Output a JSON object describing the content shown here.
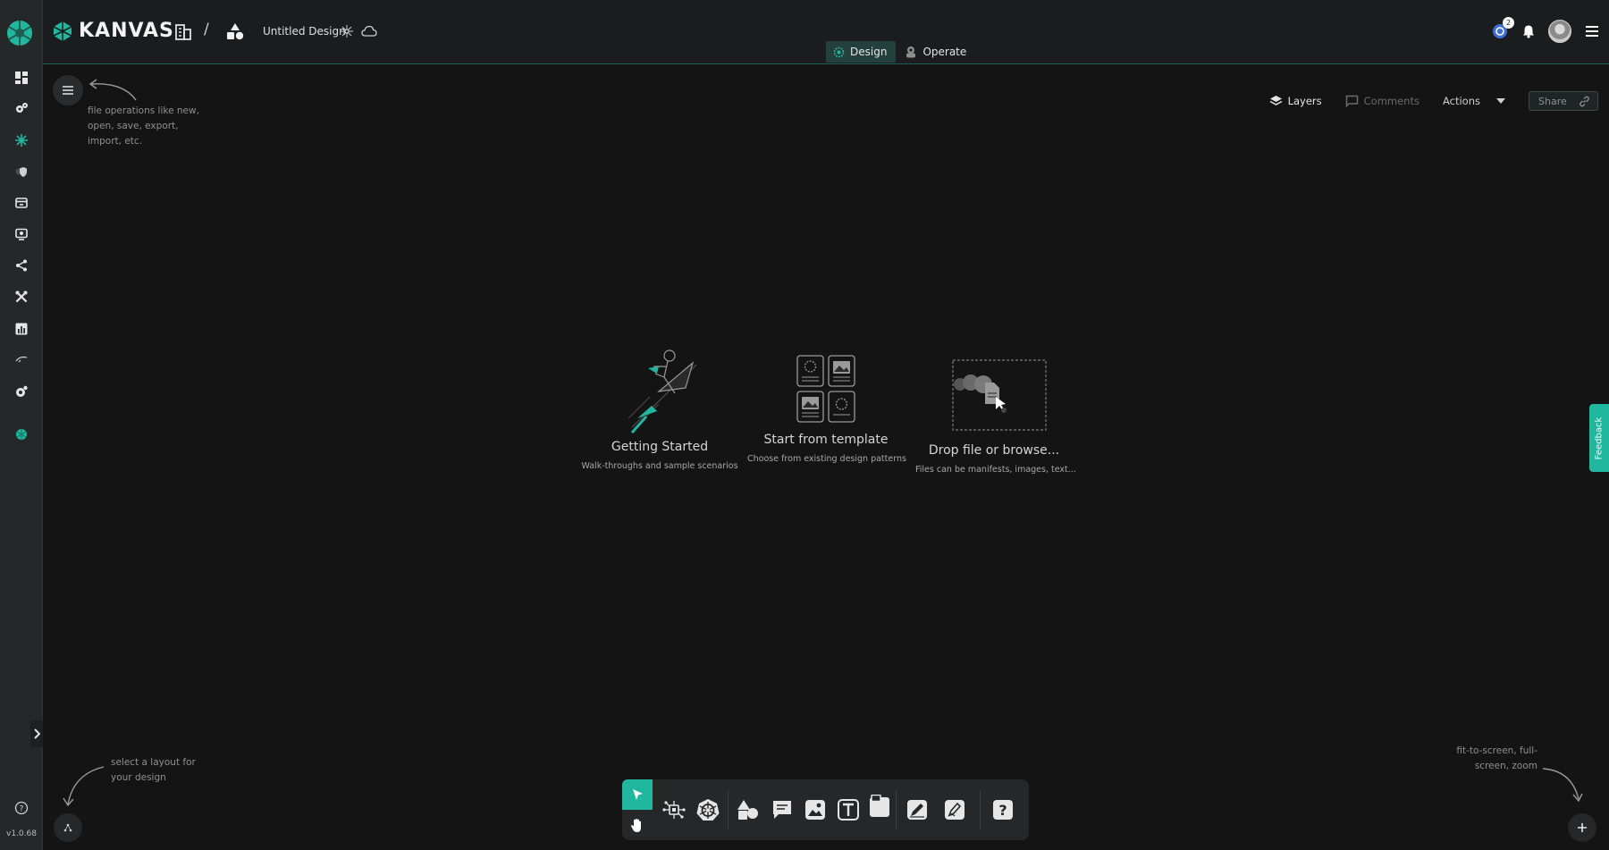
{
  "app": {
    "brand": "KANVAS",
    "design_name": "Untitled Design",
    "breadcrumb_separator": "/",
    "version": "v1.0.68",
    "accent_color": "#1fb79d"
  },
  "header": {
    "mode_tabs": [
      {
        "label": "Design",
        "icon": "design-cog-icon",
        "active": true
      },
      {
        "label": "Operate",
        "icon": "operator-icon",
        "active": false
      }
    ],
    "notification_count": "2"
  },
  "canvas_toolbar": {
    "layers_label": "Layers",
    "comments_label": "Comments",
    "actions_label": "Actions",
    "share_label": "Share"
  },
  "hints": {
    "file_ops": "file operations like new, open, save, export, import, etc.",
    "layout": "select a layout for your design",
    "zoom": "fit-to-screen, full-screen, zoom"
  },
  "starters": [
    {
      "title": "Getting Started",
      "subtitle": "Walk-throughs and sample scenarios"
    },
    {
      "title": "Start from template",
      "subtitle": "Choose from existing design patterns"
    },
    {
      "title": "Drop file or browse...",
      "subtitle": "Files can be manifests, images, text..."
    }
  ],
  "feedback_label": "Feedback",
  "sidebar_icons": [
    "dashboard-icon",
    "lifecycle-icon",
    "kanvas-icon",
    "security-icon",
    "catalog-icon",
    "extensions-icon",
    "connections-icon",
    "tools-icon",
    "performance-icon",
    "registry-icon",
    "settings-icon",
    "meshery-icon"
  ]
}
